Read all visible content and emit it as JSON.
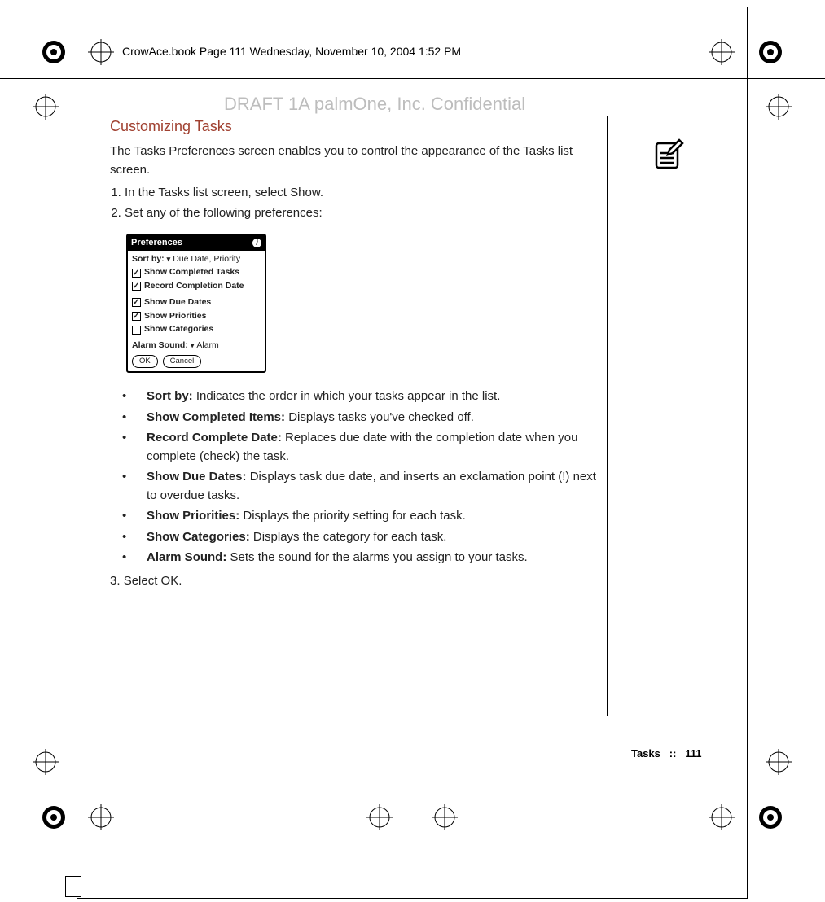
{
  "header": "CrowAce.book  Page 111  Wednesday, November 10, 2004  1:52 PM",
  "watermark": "DRAFT 1A  palmOne, Inc.   Confidential",
  "title": "Customizing Tasks",
  "intro": "The Tasks Preferences screen enables you to control the appearance of the Tasks list  screen.",
  "step1": "In the Tasks list screen, select Show.",
  "step2": "Set any of the following preferences:",
  "step3": "Select OK.",
  "prefs": {
    "title": "Preferences",
    "sortby_label": "Sort by:",
    "sortby_value": "Due Date, Priority",
    "rows": [
      {
        "label": "Show Completed Tasks",
        "checked": true
      },
      {
        "label": "Record Completion Date",
        "checked": true
      },
      {
        "label": "Show Due Dates",
        "checked": true
      },
      {
        "label": "Show Priorities",
        "checked": true
      },
      {
        "label": "Show Categories",
        "checked": false
      }
    ],
    "alarm_label": "Alarm Sound:",
    "alarm_value": "Alarm",
    "ok": "OK",
    "cancel": "Cancel"
  },
  "bullets": [
    {
      "label": "Sort by:",
      "text": " Indicates the order in which your tasks appear in the list."
    },
    {
      "label": "Show Completed Items:",
      "text": " Displays tasks you've checked off."
    },
    {
      "label": "Record Complete Date:",
      "text": " Replaces due date with the completion date when you complete (check) the task."
    },
    {
      "label": "Show Due Dates:",
      "text": " Displays task due date, and inserts an exclamation point (!) next to overdue tasks."
    },
    {
      "label": "Show Priorities:",
      "text": " Displays the priority setting for each task."
    },
    {
      "label": "Show Categories:",
      "text": " Displays the category for each task."
    },
    {
      "label": "Alarm Sound:",
      "text": " Sets the sound for the alarms you assign to your tasks."
    }
  ],
  "footer": {
    "section": "Tasks",
    "sep": "::",
    "page": "111"
  }
}
